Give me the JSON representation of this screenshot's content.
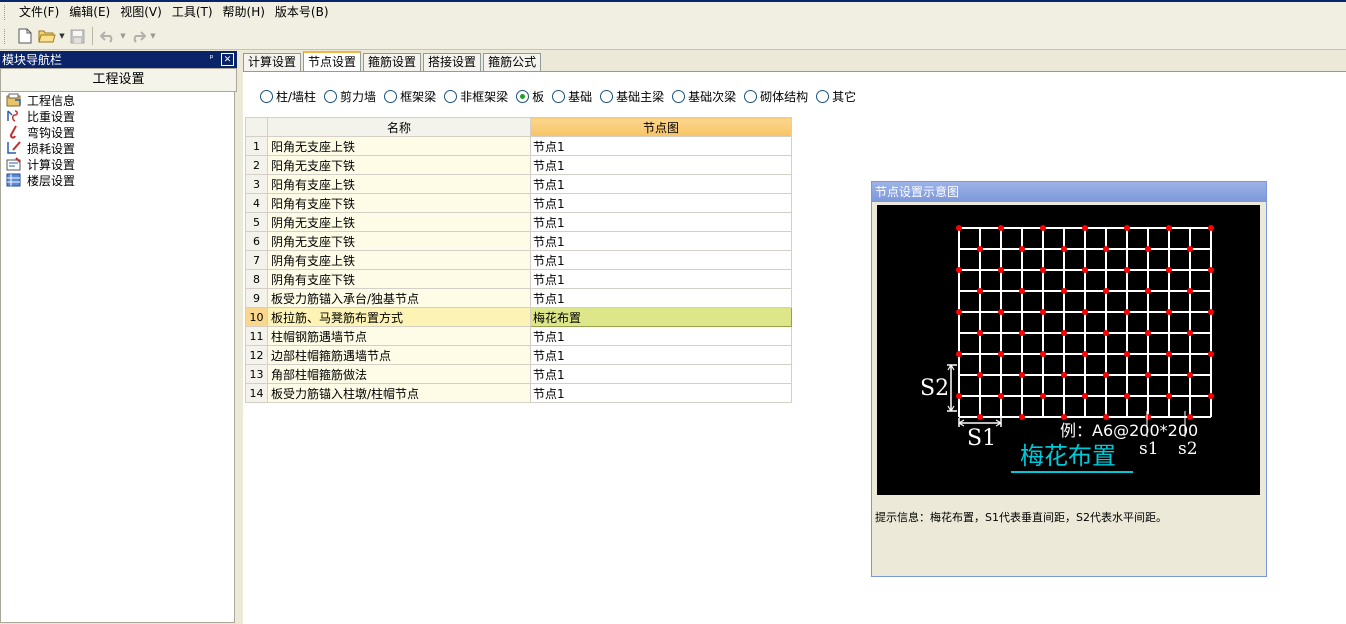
{
  "menubar": {
    "items": [
      "文件(F)",
      "编辑(E)",
      "视图(V)",
      "工具(T)",
      "帮助(H)",
      "版本号(B)"
    ]
  },
  "toolbar": {
    "buttons": [
      "new-file-icon",
      "open-folder-icon",
      "save-icon",
      "undo-icon",
      "redo-icon"
    ]
  },
  "left_panel": {
    "title": "模块导航栏",
    "pin_glyph": "ᵖ",
    "close_glyph": "✕",
    "header": "工程设置",
    "items": [
      {
        "label": "工程信息",
        "icon": "project-info-icon"
      },
      {
        "label": "比重设置",
        "icon": "weight-ratio-icon"
      },
      {
        "label": "弯钩设置",
        "icon": "hook-icon"
      },
      {
        "label": "损耗设置",
        "icon": "loss-icon"
      },
      {
        "label": "计算设置",
        "icon": "calc-icon"
      },
      {
        "label": "楼层设置",
        "icon": "floor-icon"
      }
    ]
  },
  "tabs": [
    {
      "label": "计算设置",
      "active": false
    },
    {
      "label": "节点设置",
      "active": true
    },
    {
      "label": "箍筋设置",
      "active": false
    },
    {
      "label": "搭接设置",
      "active": false
    },
    {
      "label": "箍筋公式",
      "active": false
    }
  ],
  "radios": [
    {
      "label": "柱/墙柱",
      "checked": false
    },
    {
      "label": "剪力墙",
      "checked": false
    },
    {
      "label": "框架梁",
      "checked": false
    },
    {
      "label": "非框架梁",
      "checked": false
    },
    {
      "label": "板",
      "checked": true
    },
    {
      "label": "基础",
      "checked": false
    },
    {
      "label": "基础主梁",
      "checked": false
    },
    {
      "label": "基础次梁",
      "checked": false
    },
    {
      "label": "砌体结构",
      "checked": false
    },
    {
      "label": "其它",
      "checked": false
    }
  ],
  "grid": {
    "columns": [
      "名称",
      "节点图"
    ],
    "selected_row": 10,
    "rows": [
      {
        "num": "1",
        "name": "阳角无支座上铁",
        "value": "节点1"
      },
      {
        "num": "2",
        "name": "阳角无支座下铁",
        "value": "节点1"
      },
      {
        "num": "3",
        "name": "阳角有支座上铁",
        "value": "节点1"
      },
      {
        "num": "4",
        "name": "阳角有支座下铁",
        "value": "节点1"
      },
      {
        "num": "5",
        "name": "阴角无支座上铁",
        "value": "节点1"
      },
      {
        "num": "6",
        "name": "阴角无支座下铁",
        "value": "节点1"
      },
      {
        "num": "7",
        "name": "阴角有支座上铁",
        "value": "节点1"
      },
      {
        "num": "8",
        "name": "阴角有支座下铁",
        "value": "节点1"
      },
      {
        "num": "9",
        "name": "板受力筋锚入承台/独基节点",
        "value": "节点1"
      },
      {
        "num": "10",
        "name": "板拉筋、马凳筋布置方式",
        "value": "梅花布置"
      },
      {
        "num": "11",
        "name": "柱帽钢筋遇墙节点",
        "value": "节点1"
      },
      {
        "num": "12",
        "name": "边部柱帽箍筋遇墙节点",
        "value": "节点1"
      },
      {
        "num": "13",
        "name": "角部柱帽箍筋做法",
        "value": "节点1"
      },
      {
        "num": "14",
        "name": "板受力筋锚入柱墩/柱帽节点",
        "value": "节点1"
      }
    ]
  },
  "diagram": {
    "title": "节点设置示意图",
    "label_s2": "S2",
    "label_s1": "S1",
    "example": "例：A6@200*200",
    "s1": "s1",
    "s2": "s2",
    "caption": "梅花布置",
    "info": "提示信息：梅花布置，S1代表垂直间距，S2代表水平间距。",
    "colors": {
      "grid": "#ffffff",
      "dot": "#ff0000",
      "caption": "#00c8d8",
      "background": "#000000"
    }
  }
}
